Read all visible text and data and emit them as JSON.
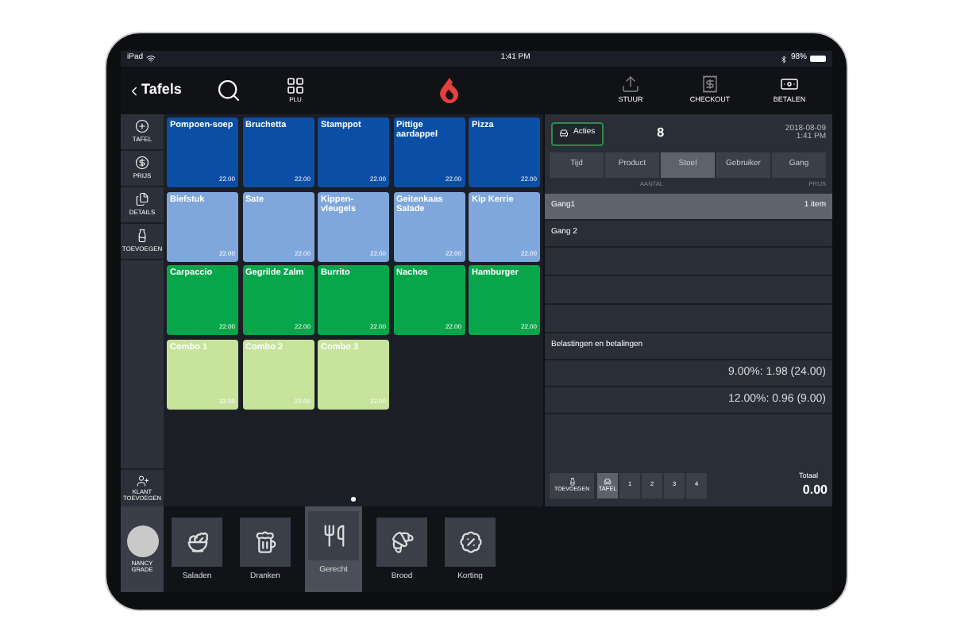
{
  "status_bar": {
    "carrier": "iPad",
    "time": "1:41 PM",
    "battery": "98%"
  },
  "top_bar": {
    "back": "Tafels",
    "plu": "PLU",
    "actions": [
      {
        "kind": "send",
        "label": "STUUR"
      },
      {
        "kind": "checkout",
        "label": "CHECKOUT"
      },
      {
        "kind": "pay",
        "label": "BETALEN"
      }
    ]
  },
  "sidebar": {
    "items": [
      {
        "kind": "add",
        "label": "TAFEL"
      },
      {
        "kind": "price",
        "label": "PRIJS"
      },
      {
        "kind": "details",
        "label": "DETAILS"
      },
      {
        "kind": "bottles",
        "label": "TOEVOEGEN"
      }
    ],
    "customer": {
      "line_1": "KLANT",
      "line_2": "TOEVOEGEN"
    },
    "user": {
      "line_1": "NANCY",
      "line_2": "GRADE"
    }
  },
  "products": [
    {
      "name": "Pompoen-soep",
      "price": "22.00",
      "color": "#0b4ea6"
    },
    {
      "name": "Bruchetta",
      "price": "22.00",
      "color": "#0b4ea6"
    },
    {
      "name": "Stamppot",
      "price": "22.00",
      "color": "#0b4ea6"
    },
    {
      "name": "Pittige aardappel",
      "price": "22.00",
      "color": "#0b4ea6"
    },
    {
      "name": "Pizza",
      "price": "22.00",
      "color": "#0b4ea6"
    },
    {
      "name": "Biefstuk",
      "price": "22.00",
      "color": "#7fa7dc"
    },
    {
      "name": "Sate",
      "price": "22.00",
      "color": "#7fa7dc"
    },
    {
      "name": "Kippen-vleugels",
      "price": "22.00",
      "color": "#7fa7dc"
    },
    {
      "name": "Geitenkaas Salade",
      "price": "22.00",
      "color": "#7fa7dc"
    },
    {
      "name": "Kip Kerrie",
      "price": "22.00",
      "color": "#7fa7dc"
    },
    {
      "name": "Carpaccio",
      "price": "22.00",
      "color": "#08a64b"
    },
    {
      "name": "Gegrilde Zalm",
      "price": "22.00",
      "color": "#08a64b"
    },
    {
      "name": "Burrito",
      "price": "22.00",
      "color": "#08a64b"
    },
    {
      "name": "Nachos",
      "price": "22.00",
      "color": "#08a64b"
    },
    {
      "name": "Hamburger",
      "price": "22.00",
      "color": "#08a64b"
    },
    {
      "name": "Combo 1",
      "price": "22.00",
      "color": "#c7e39c"
    },
    {
      "name": "Combo 2",
      "price": "22.00",
      "color": "#c7e39c"
    },
    {
      "name": "Combo 3",
      "price": "22.00",
      "color": "#c7e39c"
    }
  ],
  "categories": [
    {
      "kind": "salad",
      "label": "Saladen",
      "selected": false
    },
    {
      "kind": "beer",
      "label": "Dranken",
      "selected": false
    },
    {
      "kind": "dish",
      "label": "Gerecht",
      "selected": true
    },
    {
      "kind": "bread",
      "label": "Brood",
      "selected": false
    },
    {
      "kind": "discount",
      "label": "Korting",
      "selected": false
    }
  ],
  "order": {
    "actions_button": "Acties",
    "count": "8",
    "date": "2018-08-09",
    "time": "1:41 PM",
    "tabs": [
      {
        "label": "Tijd",
        "selected": false
      },
      {
        "label": "Product",
        "selected": false
      },
      {
        "label": "Stoel",
        "selected": true
      },
      {
        "label": "Gebruiker",
        "selected": false
      },
      {
        "label": "Gang",
        "selected": false
      }
    ],
    "columns": [
      "AANTAL",
      "PRIJS"
    ],
    "rows": [
      {
        "label": "Gang1",
        "value": "1 item",
        "selected": true
      },
      {
        "label": "Gang 2",
        "selected": false
      }
    ],
    "taxes_heading": "Belastingen en betalingen",
    "taxes": [
      "9.00%: 1.98 (24.00)",
      "12.00%: 0.96 (9.00)"
    ],
    "add_button": "TOEVOEGEN",
    "seats": [
      {
        "label": "TAFEL",
        "kind": "table",
        "selected": true
      },
      {
        "label": "1",
        "selected": false
      },
      {
        "label": "2",
        "selected": false
      },
      {
        "label": "3",
        "selected": false
      },
      {
        "label": "4",
        "selected": false
      }
    ],
    "total_label": "Totaal",
    "total": "0.00"
  }
}
